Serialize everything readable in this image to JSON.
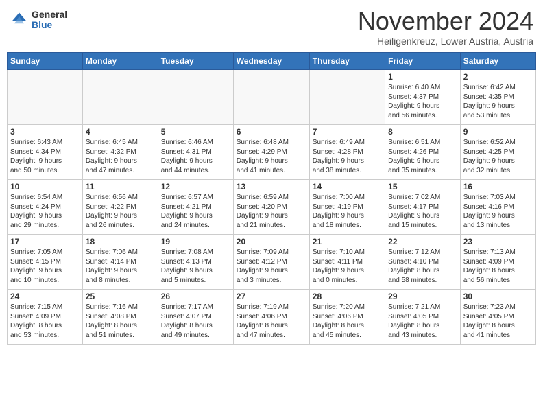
{
  "header": {
    "logo_general": "General",
    "logo_blue": "Blue",
    "month": "November 2024",
    "location": "Heiligenkreuz, Lower Austria, Austria"
  },
  "weekdays": [
    "Sunday",
    "Monday",
    "Tuesday",
    "Wednesday",
    "Thursday",
    "Friday",
    "Saturday"
  ],
  "weeks": [
    [
      {
        "day": "",
        "info": ""
      },
      {
        "day": "",
        "info": ""
      },
      {
        "day": "",
        "info": ""
      },
      {
        "day": "",
        "info": ""
      },
      {
        "day": "",
        "info": ""
      },
      {
        "day": "1",
        "info": "Sunrise: 6:40 AM\nSunset: 4:37 PM\nDaylight: 9 hours\nand 56 minutes."
      },
      {
        "day": "2",
        "info": "Sunrise: 6:42 AM\nSunset: 4:35 PM\nDaylight: 9 hours\nand 53 minutes."
      }
    ],
    [
      {
        "day": "3",
        "info": "Sunrise: 6:43 AM\nSunset: 4:34 PM\nDaylight: 9 hours\nand 50 minutes."
      },
      {
        "day": "4",
        "info": "Sunrise: 6:45 AM\nSunset: 4:32 PM\nDaylight: 9 hours\nand 47 minutes."
      },
      {
        "day": "5",
        "info": "Sunrise: 6:46 AM\nSunset: 4:31 PM\nDaylight: 9 hours\nand 44 minutes."
      },
      {
        "day": "6",
        "info": "Sunrise: 6:48 AM\nSunset: 4:29 PM\nDaylight: 9 hours\nand 41 minutes."
      },
      {
        "day": "7",
        "info": "Sunrise: 6:49 AM\nSunset: 4:28 PM\nDaylight: 9 hours\nand 38 minutes."
      },
      {
        "day": "8",
        "info": "Sunrise: 6:51 AM\nSunset: 4:26 PM\nDaylight: 9 hours\nand 35 minutes."
      },
      {
        "day": "9",
        "info": "Sunrise: 6:52 AM\nSunset: 4:25 PM\nDaylight: 9 hours\nand 32 minutes."
      }
    ],
    [
      {
        "day": "10",
        "info": "Sunrise: 6:54 AM\nSunset: 4:24 PM\nDaylight: 9 hours\nand 29 minutes."
      },
      {
        "day": "11",
        "info": "Sunrise: 6:56 AM\nSunset: 4:22 PM\nDaylight: 9 hours\nand 26 minutes."
      },
      {
        "day": "12",
        "info": "Sunrise: 6:57 AM\nSunset: 4:21 PM\nDaylight: 9 hours\nand 24 minutes."
      },
      {
        "day": "13",
        "info": "Sunrise: 6:59 AM\nSunset: 4:20 PM\nDaylight: 9 hours\nand 21 minutes."
      },
      {
        "day": "14",
        "info": "Sunrise: 7:00 AM\nSunset: 4:19 PM\nDaylight: 9 hours\nand 18 minutes."
      },
      {
        "day": "15",
        "info": "Sunrise: 7:02 AM\nSunset: 4:17 PM\nDaylight: 9 hours\nand 15 minutes."
      },
      {
        "day": "16",
        "info": "Sunrise: 7:03 AM\nSunset: 4:16 PM\nDaylight: 9 hours\nand 13 minutes."
      }
    ],
    [
      {
        "day": "17",
        "info": "Sunrise: 7:05 AM\nSunset: 4:15 PM\nDaylight: 9 hours\nand 10 minutes."
      },
      {
        "day": "18",
        "info": "Sunrise: 7:06 AM\nSunset: 4:14 PM\nDaylight: 9 hours\nand 8 minutes."
      },
      {
        "day": "19",
        "info": "Sunrise: 7:08 AM\nSunset: 4:13 PM\nDaylight: 9 hours\nand 5 minutes."
      },
      {
        "day": "20",
        "info": "Sunrise: 7:09 AM\nSunset: 4:12 PM\nDaylight: 9 hours\nand 3 minutes."
      },
      {
        "day": "21",
        "info": "Sunrise: 7:10 AM\nSunset: 4:11 PM\nDaylight: 9 hours\nand 0 minutes."
      },
      {
        "day": "22",
        "info": "Sunrise: 7:12 AM\nSunset: 4:10 PM\nDaylight: 8 hours\nand 58 minutes."
      },
      {
        "day": "23",
        "info": "Sunrise: 7:13 AM\nSunset: 4:09 PM\nDaylight: 8 hours\nand 56 minutes."
      }
    ],
    [
      {
        "day": "24",
        "info": "Sunrise: 7:15 AM\nSunset: 4:09 PM\nDaylight: 8 hours\nand 53 minutes."
      },
      {
        "day": "25",
        "info": "Sunrise: 7:16 AM\nSunset: 4:08 PM\nDaylight: 8 hours\nand 51 minutes."
      },
      {
        "day": "26",
        "info": "Sunrise: 7:17 AM\nSunset: 4:07 PM\nDaylight: 8 hours\nand 49 minutes."
      },
      {
        "day": "27",
        "info": "Sunrise: 7:19 AM\nSunset: 4:06 PM\nDaylight: 8 hours\nand 47 minutes."
      },
      {
        "day": "28",
        "info": "Sunrise: 7:20 AM\nSunset: 4:06 PM\nDaylight: 8 hours\nand 45 minutes."
      },
      {
        "day": "29",
        "info": "Sunrise: 7:21 AM\nSunset: 4:05 PM\nDaylight: 8 hours\nand 43 minutes."
      },
      {
        "day": "30",
        "info": "Sunrise: 7:23 AM\nSunset: 4:05 PM\nDaylight: 8 hours\nand 41 minutes."
      }
    ]
  ]
}
